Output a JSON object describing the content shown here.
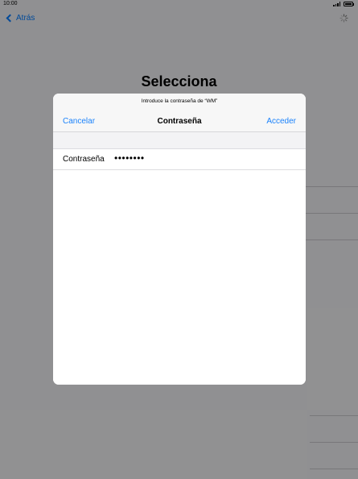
{
  "status_bar": {
    "time": "10:00",
    "signal_icon": "cell-signal-icon",
    "battery_icon": "battery-icon"
  },
  "background": {
    "back_label": "Atrás",
    "back_icon": "chevron-left-icon",
    "spinner_icon": "activity-spinner-icon",
    "title": "Selecciona"
  },
  "modal": {
    "prompt": "Introduce la contraseña de “WM”",
    "cancel_label": "Cancelar",
    "title": "Contraseña",
    "accept_label": "Acceder",
    "password_field": {
      "label": "Contraseña",
      "value": "••••••••"
    }
  },
  "colors": {
    "accent": "#1a82fb",
    "overlay": "#8a8a8e",
    "sheet": "#ffffff"
  }
}
